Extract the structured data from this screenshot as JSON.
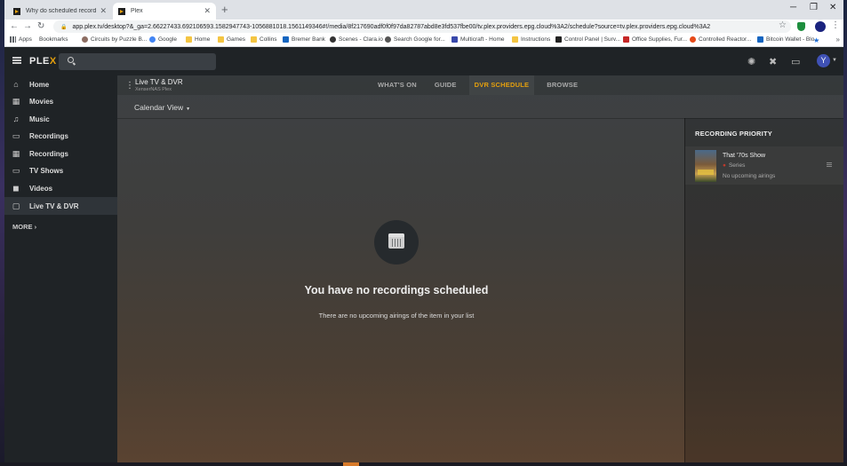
{
  "browser": {
    "tabs": [
      {
        "title": "Why do scheduled recordings d..."
      },
      {
        "title": "Plex"
      }
    ],
    "url": "app.plex.tv/desktop?&_ga=2.66227433.692106593.1582947743-1056881018.1561149346#!/media/8f217690adf0f0f97da82787abd8e3fd537fbe00/tv.plex.providers.epg.cloud%3A2/schedule?source=tv.plex.providers.epg.cloud%3A2",
    "bookmarks": [
      "Apps",
      "Bookmarks",
      "Circuits by Puzzle B...",
      "Google",
      "Home",
      "Games",
      "Collins",
      "Bremer Bank",
      "Scenes - Clara.io",
      "Search Google for...",
      "Multicraft - Home",
      "Instructions",
      "Control Panel | Surv...",
      "Office Supplies, Fur...",
      "Controlled Reactor...",
      "Bitcoin Wallet - Blo..."
    ]
  },
  "plex": {
    "logo": {
      "text": "PLE",
      "accent": "X"
    },
    "avatar_letter": "Y",
    "sidebar": [
      {
        "label": "Home",
        "icon": "home-icon"
      },
      {
        "label": "Movies",
        "icon": "film-icon"
      },
      {
        "label": "Music",
        "icon": "music-icon"
      },
      {
        "label": "Recordings",
        "icon": "monitor-icon"
      },
      {
        "label": "Recordings",
        "icon": "film-icon"
      },
      {
        "label": "TV Shows",
        "icon": "monitor-icon"
      },
      {
        "label": "Videos",
        "icon": "video-icon"
      },
      {
        "label": "Live TV & DVR",
        "icon": "tv-icon"
      }
    ],
    "more_label": "MORE",
    "section": {
      "title": "Live TV & DVR",
      "server": "XenserNAS Plex"
    },
    "tabs": [
      "WHAT'S ON",
      "GUIDE",
      "DVR SCHEDULE",
      "BROWSE"
    ],
    "active_tab": "DVR SCHEDULE",
    "calendar_view": "Calendar View",
    "empty": {
      "title": "You have no recordings scheduled",
      "subtitle": "There are no upcoming airings of the item in your list"
    },
    "priority": {
      "title": "RECORDING PRIORITY",
      "items": [
        {
          "title": "That '70s Show",
          "type": "Series",
          "status": "No upcoming airings"
        }
      ]
    },
    "colors": {
      "accent": "#e5a00d",
      "background": "#1f2326"
    }
  }
}
